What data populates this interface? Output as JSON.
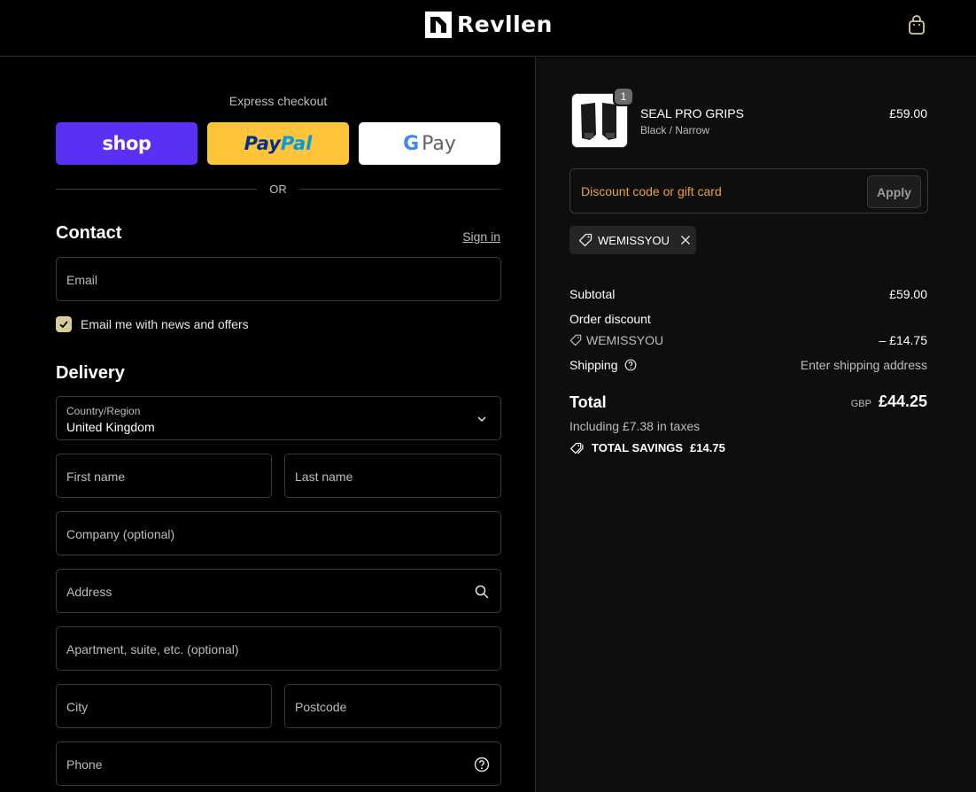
{
  "header": {
    "brand": "Revllen",
    "cart_icon": "shopping-bag-icon"
  },
  "express": {
    "title": "Express checkout",
    "shop_label": "shop",
    "paypal_label_1": "Pay",
    "paypal_label_2": "Pal",
    "gpay_g": "G",
    "gpay_label": "Pay",
    "or_label": "OR"
  },
  "contact": {
    "title": "Contact",
    "signin_label": "Sign in",
    "email_placeholder": "Email",
    "newsletter_label": "Email me with news and offers",
    "newsletter_checked": true
  },
  "delivery": {
    "title": "Delivery",
    "country_label": "Country/Region",
    "country_value": "United Kingdom",
    "first_name": "First name",
    "last_name": "Last name",
    "company": "Company (optional)",
    "address": "Address",
    "apartment": "Apartment, suite, etc. (optional)",
    "city": "City",
    "postcode": "Postcode",
    "phone": "Phone"
  },
  "summary": {
    "product": {
      "name": "SEAL PRO GRIPS",
      "variant": "Black / Narrow",
      "price": "£59.00",
      "quantity": "1"
    },
    "discount_placeholder": "Discount code or gift card",
    "apply_label": "Apply",
    "applied_code": "WEMISSYOU",
    "subtotal_label": "Subtotal",
    "subtotal_value": "£59.00",
    "order_discount_label": "Order discount",
    "discount_code": "WEMISSYOU",
    "discount_value": "– £14.75",
    "shipping_label": "Shipping",
    "shipping_value": "Enter shipping address",
    "total_label": "Total",
    "currency": "GBP",
    "total_value": "£44.25",
    "taxes": "Including £7.38 in taxes",
    "savings_label": "TOTAL SAVINGS",
    "savings_value": "£14.75"
  },
  "colors": {
    "background": "#000000",
    "summary_bg": "#0e0e0e",
    "shop_pay": "#5a31f4",
    "paypal": "#ffc439",
    "discount_accent": "#e8a23b",
    "checkbox": "#d8cc9a"
  }
}
